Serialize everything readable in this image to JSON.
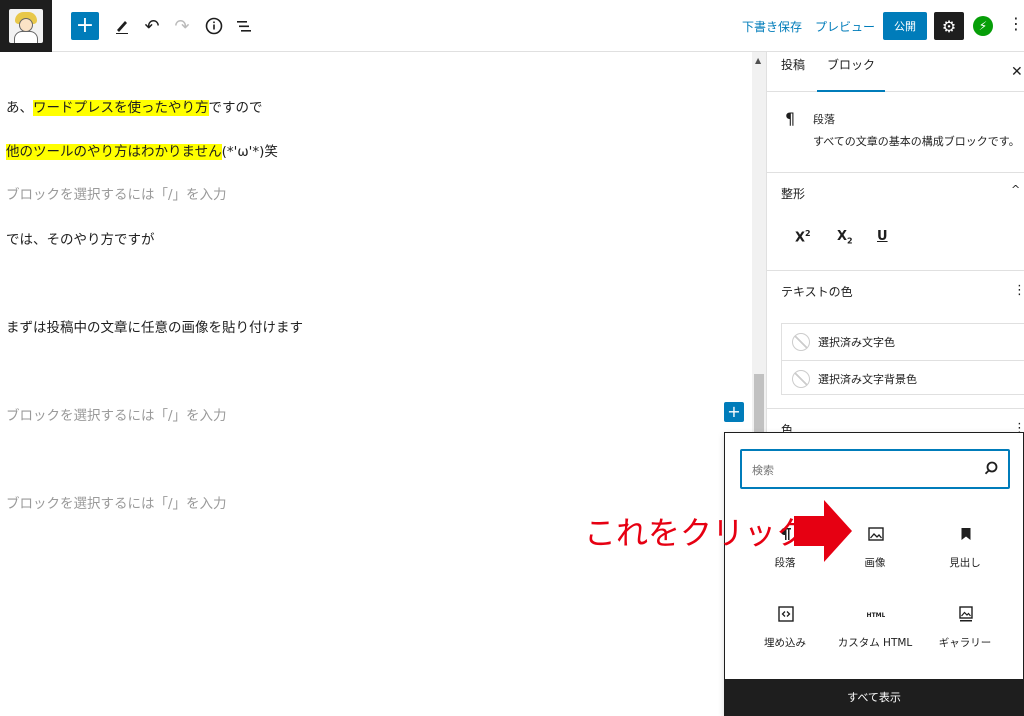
{
  "toolbar": {
    "add_icon": "plus-icon",
    "tools_icon": "pencil-icon",
    "undo_icon": "undo-icon",
    "redo_icon": "redo-icon",
    "info_icon": "info-icon",
    "outline_icon": "list-view-icon",
    "draft_label": "下書き保存",
    "preview_label": "プレビュー",
    "publish_label": "公開",
    "settings_icon": "gear-icon",
    "jetpack_icon": "bolt-icon",
    "more_icon": "vertical-ellipsis-icon"
  },
  "editor": {
    "p1_before": "あ、",
    "p1_highlight": "ワードプレスを使ったやり方",
    "p1_after": "ですので",
    "p2_highlight": "他のツールのやり方はわかりません",
    "p2_after": "(*'ω'*)笑",
    "placeholder": "ブロックを選択するには「/」を入力",
    "p4": "では、そのやり方ですが",
    "p5": "まずは投稿中の文章に任意の画像を貼り付けます"
  },
  "sidebar": {
    "tab_post": "投稿",
    "tab_block": "ブロック",
    "block_title": "段落",
    "block_desc": "すべての文章の基本の構成ブロックです。",
    "format_title": "整形",
    "text_color_title": "テキストの色",
    "selected_text_color": "選択済み文字色",
    "selected_bg_color": "選択済み文字背景色",
    "color_title": "色"
  },
  "inserter": {
    "search_placeholder": "検索",
    "items": [
      {
        "label": "段落",
        "icon": "paragraph-icon"
      },
      {
        "label": "画像",
        "icon": "image-icon"
      },
      {
        "label": "見出し",
        "icon": "bookmark-icon"
      },
      {
        "label": "埋め込み",
        "icon": "embed-icon"
      },
      {
        "label": "カスタム HTML",
        "icon": "html-icon"
      },
      {
        "label": "ギャラリー",
        "icon": "gallery-icon"
      }
    ],
    "show_all": "すべて表示"
  },
  "annotation": {
    "text": "これをクリック",
    "color": "#e60012"
  },
  "colors": {
    "accent": "#007cba",
    "highlight": "#ffff00",
    "dark": "#1e1e1e"
  }
}
